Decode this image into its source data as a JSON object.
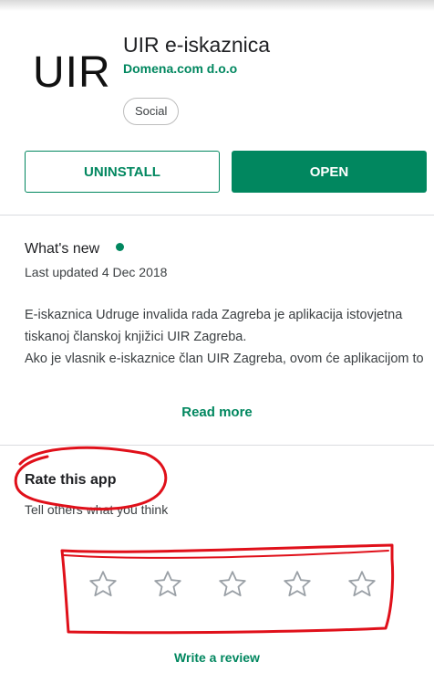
{
  "app": {
    "logo_text": "UIR",
    "title": "UIR e-iskaznica",
    "developer": "Domena.com d.o.o",
    "category": "Social"
  },
  "actions": {
    "uninstall_label": "UNINSTALL",
    "open_label": "OPEN"
  },
  "whats_new": {
    "title": "What's new",
    "updated": "Last updated 4 Dec 2018",
    "description": [
      "E-iskaznica Udruge invalida rada Zagreba je aplikacija istovjetna",
      "tiskanoj članskoj knjižici UIR Zagreba.",
      "Ako je vlasnik e-iskaznice član UIR Zagreba, ovom će aplikacijom to"
    ],
    "read_more": "Read more"
  },
  "rating": {
    "title": "Rate this app",
    "subtitle": "Tell others what you think",
    "stars": 5,
    "write_review": "Write a review"
  },
  "colors": {
    "accent": "#01875f",
    "annotation": "#e0101a"
  }
}
